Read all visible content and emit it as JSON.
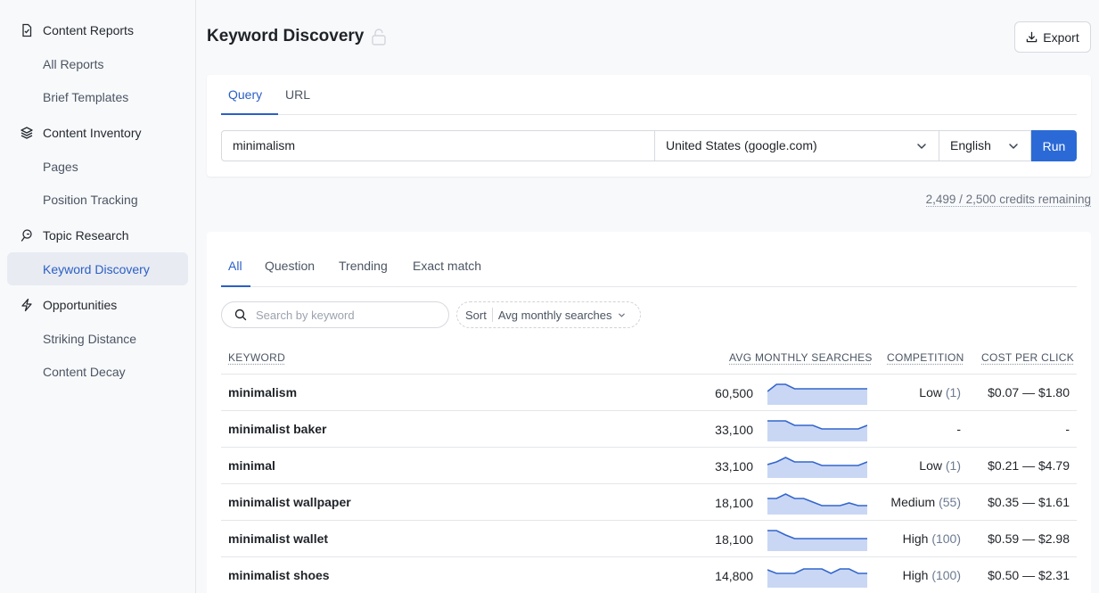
{
  "sidebar": {
    "groups": [
      {
        "label": "Content Reports",
        "icon": "document-icon",
        "items": [
          "All Reports",
          "Brief Templates"
        ]
      },
      {
        "label": "Content Inventory",
        "icon": "layers-icon",
        "items": [
          "Pages",
          "Position Tracking"
        ]
      },
      {
        "label": "Topic Research",
        "icon": "lightbulb-icon",
        "items": [
          "Keyword Discovery"
        ]
      },
      {
        "label": "Opportunities",
        "icon": "lightning-icon",
        "items": [
          "Striking Distance",
          "Content Decay"
        ]
      }
    ],
    "active_item": "Keyword Discovery"
  },
  "header": {
    "title": "Keyword Discovery",
    "export_label": "Export"
  },
  "query": {
    "tabs": [
      "Query",
      "URL"
    ],
    "active_tab": "Query",
    "input_value": "minimalism",
    "location": "United States (google.com)",
    "language": "English",
    "run_label": "Run"
  },
  "credits": "2,499 / 2,500 credits remaining",
  "results": {
    "tabs": [
      "All",
      "Question",
      "Trending",
      "Exact match"
    ],
    "active_tab": "All",
    "search_placeholder": "Search by keyword",
    "sort_label": "Sort",
    "sort_value": "Avg monthly searches",
    "columns": {
      "keyword": "KEYWORD",
      "volume": "AVG MONTHLY SEARCHES",
      "competition": "COMPETITION",
      "cpc": "COST PER CLICK"
    },
    "rows": [
      {
        "keyword": "minimalism",
        "volume": "60,500",
        "competition": "Low",
        "competition_score": "(1)",
        "cpc": "$0.07 — $1.80",
        "trend": [
          0.55,
          0.95,
          0.95,
          0.7,
          0.7,
          0.7,
          0.7,
          0.7,
          0.7,
          0.7,
          0.7,
          0.7
        ]
      },
      {
        "keyword": "minimalist baker",
        "volume": "33,100",
        "competition": "-",
        "competition_score": "",
        "cpc": "-",
        "trend": [
          0.95,
          0.95,
          0.95,
          0.7,
          0.7,
          0.7,
          0.5,
          0.5,
          0.5,
          0.5,
          0.5,
          0.7
        ]
      },
      {
        "keyword": "minimal",
        "volume": "33,100",
        "competition": "Low",
        "competition_score": "(1)",
        "cpc": "$0.21 — $4.79",
        "trend": [
          0.55,
          0.7,
          0.95,
          0.7,
          0.7,
          0.7,
          0.5,
          0.5,
          0.5,
          0.5,
          0.5,
          0.7
        ]
      },
      {
        "keyword": "minimalist wallpaper",
        "volume": "18,100",
        "competition": "Medium",
        "competition_score": "(55)",
        "cpc": "$0.35 — $1.61",
        "trend": [
          0.7,
          0.7,
          0.95,
          0.7,
          0.7,
          0.5,
          0.3,
          0.3,
          0.3,
          0.45,
          0.3,
          0.3
        ]
      },
      {
        "keyword": "minimalist wallet",
        "volume": "18,100",
        "competition": "High",
        "competition_score": "(100)",
        "cpc": "$0.59 — $2.98",
        "trend": [
          0.95,
          0.95,
          0.7,
          0.5,
          0.5,
          0.5,
          0.5,
          0.5,
          0.5,
          0.5,
          0.5,
          0.5
        ]
      },
      {
        "keyword": "minimalist shoes",
        "volume": "14,800",
        "competition": "High",
        "competition_score": "(100)",
        "cpc": "$0.50 — $2.31",
        "trend": [
          0.8,
          0.6,
          0.6,
          0.6,
          0.85,
          0.85,
          0.85,
          0.6,
          0.85,
          0.85,
          0.6,
          0.6
        ]
      }
    ]
  },
  "colors": {
    "accent": "#2b5fc4",
    "run_button": "#2b6ad6",
    "spark_line": "#3366cc",
    "spark_fill": "#c9d7f5"
  }
}
